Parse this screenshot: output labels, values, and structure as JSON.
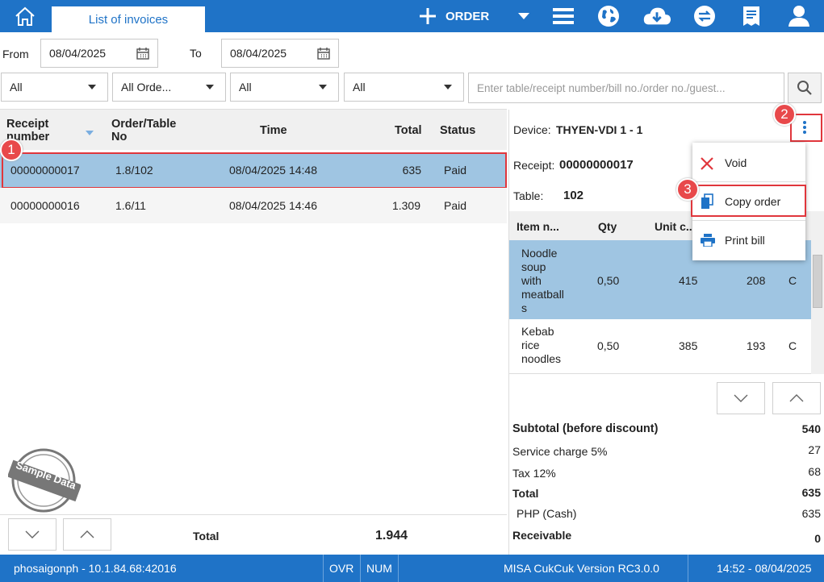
{
  "topbar": {
    "tab_label": "List of invoices",
    "order_label": "ORDER"
  },
  "filters": {
    "from_label": "From",
    "from_date": "08/04/2025",
    "to_label": "To",
    "to_date": "08/04/2025",
    "select1": "All",
    "select2": "All Orde...",
    "select3": "All",
    "select4": "All",
    "search_placeholder": "Enter table/receipt number/bill no./order no./guest..."
  },
  "list": {
    "columns": [
      "Receipt number",
      "Order/Table No",
      "Time",
      "Total",
      "Status"
    ],
    "rows": [
      {
        "receipt": "00000000017",
        "table": "1.8/102",
        "time": "08/04/2025 14:48",
        "total": "635",
        "status": "Paid"
      },
      {
        "receipt": "00000000016",
        "table": "1.6/11",
        "time": "08/04/2025 14:46",
        "total": "1.309",
        "status": "Paid"
      }
    ],
    "total_label": "Total",
    "total_value": "1.944",
    "stamp_text": "Sample Data"
  },
  "detail": {
    "device_label": "Device:",
    "device_value": "THYEN-VDI 1 - 1",
    "receipt_label": "Receipt:",
    "receipt_value": "00000000017",
    "table_label": "Table:",
    "table_value": "102",
    "item_columns": [
      "Item n...",
      "Qty",
      "Unit c..."
    ],
    "items": [
      {
        "name": "Noodle soup with meatball s",
        "name_lines": [
          "Noodle",
          "soup",
          "with",
          "meatball",
          "s"
        ],
        "qty": "0,50",
        "unit": "415",
        "amount": "208",
        "flag": "C"
      },
      {
        "name": "Kebab rice noodles",
        "name_lines": [
          "Kebab",
          "rice",
          "noodles"
        ],
        "qty": "0,50",
        "unit": "385",
        "amount": "193",
        "flag": "C"
      }
    ],
    "menu": {
      "void": "Void",
      "copy": "Copy order",
      "print": "Print bill"
    },
    "totals": {
      "subtotal_label": "Subtotal (before discount)",
      "subtotal_value": "540",
      "service_label": "Service charge 5%",
      "service_value": "27",
      "tax_label": "Tax 12%",
      "tax_value": "68",
      "total_label": "Total",
      "total_value": "635",
      "cash_label": "PHP (Cash)",
      "cash_value": "635",
      "receivable_label": "Receivable",
      "receivable_value": "0"
    }
  },
  "badges": {
    "b1": "1",
    "b2": "2",
    "b3": "3"
  },
  "status": {
    "host": "phosaigonph - 10.1.84.68:42016",
    "ovr": "OVR",
    "num": "NUM",
    "version": "MISA CukCuk Version RC3.0.0",
    "datetime": "14:52 - 08/04/2025"
  },
  "colors": {
    "primary": "#1f73c7",
    "highlight": "#9fc5e2",
    "annotation": "#e0363c"
  }
}
